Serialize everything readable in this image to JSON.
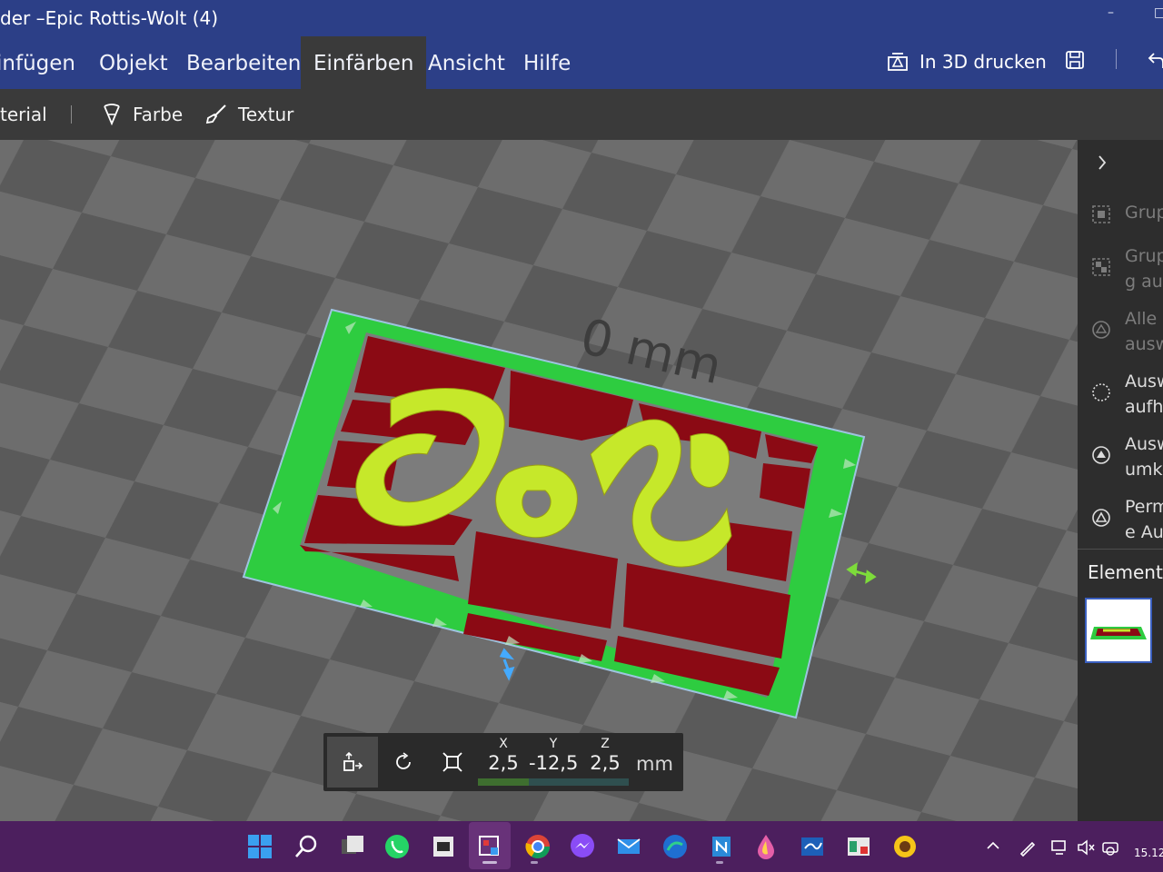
{
  "window": {
    "title": "der –Epic Rottis-Wolt (4)",
    "minimize": "–",
    "maximize": "□"
  },
  "menu": {
    "items": [
      "infügen",
      "Objekt",
      "Bearbeiten",
      "Einfärben",
      "Ansicht",
      "Hilfe"
    ],
    "active": "Einfärben",
    "print_label": "In 3D drucken"
  },
  "toolbar": {
    "material_label": "terial",
    "color_label": "Farbe",
    "texture_label": "Textur"
  },
  "viewport": {
    "dimension_label": "0 mm",
    "model_text": "Doli"
  },
  "side_panel": {
    "items": [
      {
        "label": "Grup",
        "disabled": true
      },
      {
        "label": "Grup\ng au",
        "disabled": true
      },
      {
        "label": "Alle\nausw",
        "disabled": true
      },
      {
        "label": "Ausw\naufh",
        "disabled": false
      },
      {
        "label": "Ausw\numke",
        "disabled": false
      },
      {
        "label": "Perm\ne Au",
        "disabled": false
      }
    ],
    "elements_label": "Elemente"
  },
  "transform": {
    "x_label": "X",
    "x_value": "2,5",
    "y_label": "Y",
    "y_value": "-12,5",
    "z_label": "Z",
    "z_value": "2,5",
    "unit": "mm"
  },
  "taskbar": {
    "clock": "15.12."
  },
  "colors": {
    "title_bar": "#2c3f87",
    "taskbar": "#4c1f5e",
    "base_green": "#2ecc40",
    "tile_red": "#8b0a14",
    "text_lime": "#c6e82a"
  }
}
